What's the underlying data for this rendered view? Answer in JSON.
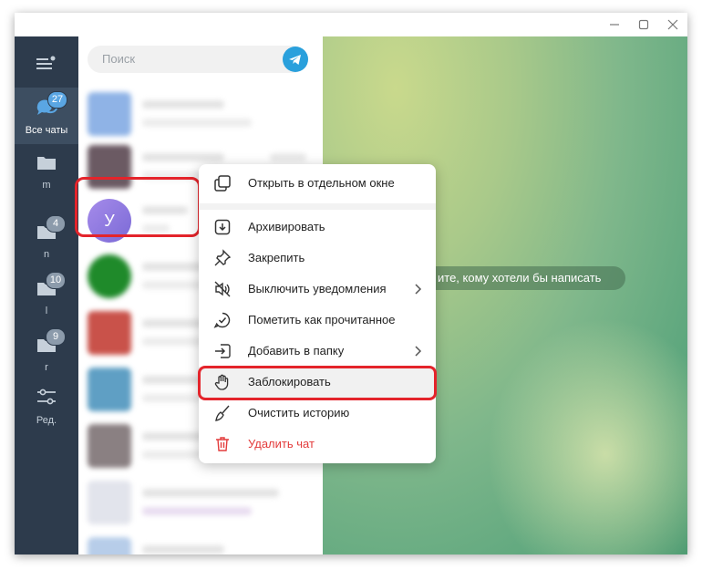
{
  "sidebar": {
    "folders": [
      {
        "label": "Все чаты",
        "badge": "27",
        "active": true
      },
      {
        "label": "m",
        "badge": ""
      },
      {
        "label": "n",
        "badge": "4"
      },
      {
        "label": "l",
        "badge": "10"
      },
      {
        "label": "r",
        "badge": "9"
      }
    ],
    "edit_label": "Ред."
  },
  "chatlist": {
    "search_placeholder": "Поиск",
    "selected_avatar_letter": "У"
  },
  "chat_area": {
    "hint": "ите, кому хотели бы написать"
  },
  "context_menu": {
    "items": [
      {
        "label": "Открыть в отдельном окне",
        "icon": "open-window-icon"
      },
      {
        "label": "Архивировать",
        "icon": "archive-icon"
      },
      {
        "label": "Закрепить",
        "icon": "pin-icon"
      },
      {
        "label": "Выключить уведомления",
        "icon": "mute-icon",
        "submenu": true
      },
      {
        "label": "Пометить как прочитанное",
        "icon": "mark-read-icon"
      },
      {
        "label": "Добавить в папку",
        "icon": "add-folder-icon",
        "submenu": true
      },
      {
        "label": "Заблокировать",
        "icon": "hand-block-icon",
        "highlighted": true
      },
      {
        "label": "Очистить историю",
        "icon": "broom-icon"
      },
      {
        "label": "Удалить чат",
        "icon": "trash-icon",
        "danger": true
      }
    ]
  },
  "colors": {
    "sidebar": "#2d3b4c",
    "accent": "#2aa0dc",
    "highlight": "#e4242b",
    "danger": "#e33b3b"
  }
}
